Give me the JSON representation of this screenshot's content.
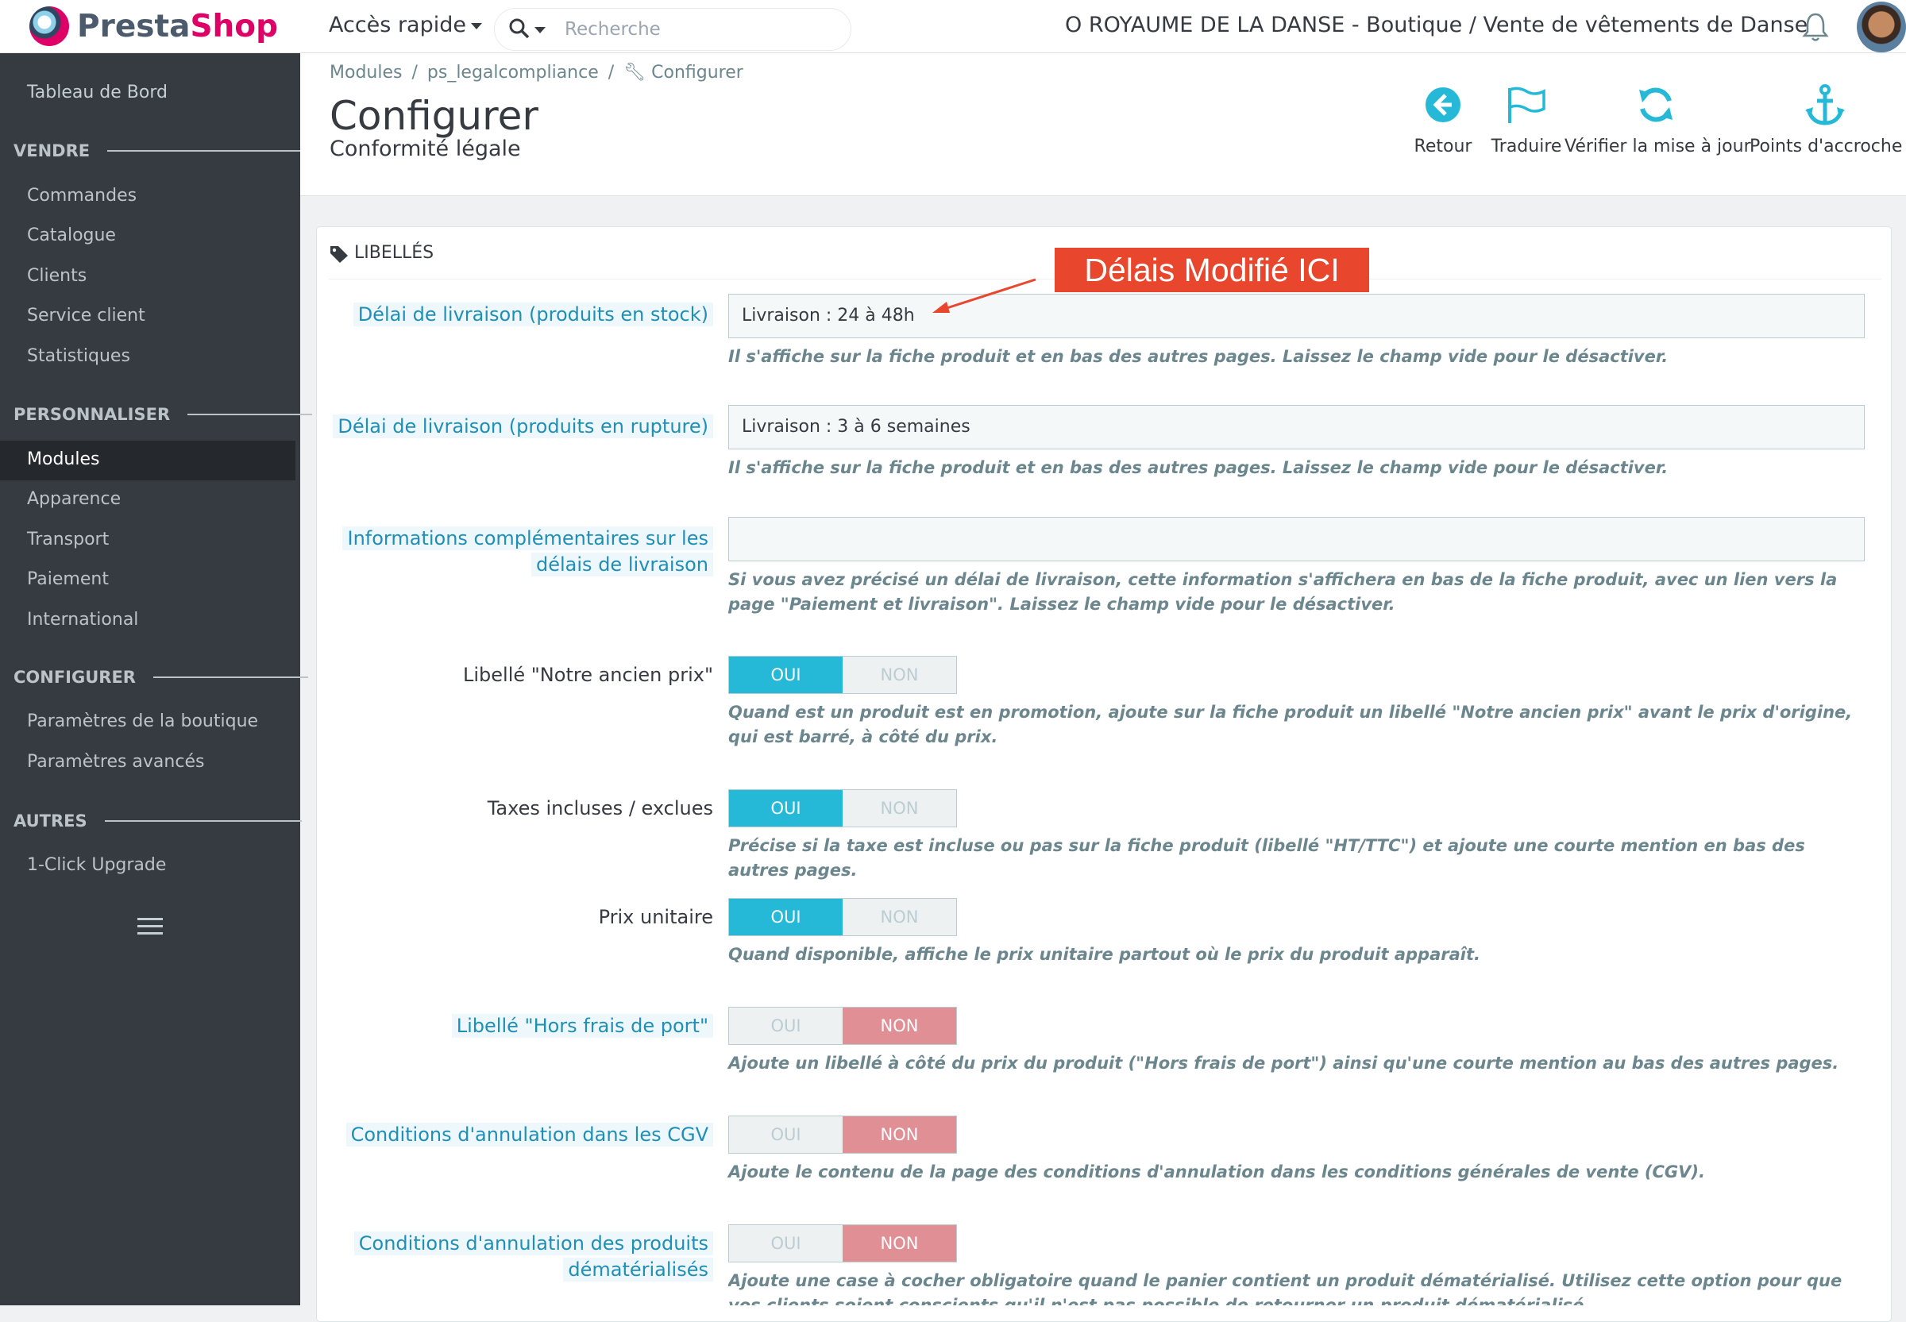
{
  "topbar": {
    "logo_part1": "Presta",
    "logo_part2": "Shop",
    "quick_access": "Accès rapide",
    "search_placeholder": "Recherche",
    "shop_name": "O ROYAUME DE LA DANSE - Boutique / Vente de vêtements de Danse"
  },
  "sidebar": {
    "dashboard": "Tableau de Bord",
    "sections": [
      {
        "title": "VENDRE",
        "items": [
          "Commandes",
          "Catalogue",
          "Clients",
          "Service client",
          "Statistiques"
        ]
      },
      {
        "title": "PERSONNALISER",
        "items": [
          "Modules",
          "Apparence",
          "Transport",
          "Paiement",
          "International"
        ]
      },
      {
        "title": "CONFIGURER",
        "items": [
          "Paramètres de la boutique",
          "Paramètres avancés"
        ]
      },
      {
        "title": "AUTRES",
        "items": [
          "1-Click Upgrade"
        ]
      }
    ],
    "active_item": "Modules"
  },
  "header": {
    "breadcrumb": [
      "Modules",
      "ps_legalcompliance",
      "Configurer"
    ],
    "title": "Configurer",
    "subtitle": "Conformité légale",
    "toolbar": [
      "Retour",
      "Traduire",
      "Vérifier la mise à jour",
      "Points d'accroche"
    ]
  },
  "panel": {
    "title": "LIBELLÉS",
    "annotation": "Délais Modifié ICI",
    "fields": [
      {
        "label": "Délai de livraison (produits en stock)",
        "value": "Livraison : 24 à 48h",
        "help": "Il s'affiche sur la fiche produit et en bas des autres pages. Laissez le champ vide pour le désactiver."
      },
      {
        "label": "Délai de livraison (produits en rupture)",
        "value": "Livraison : 3 à 6 semaines",
        "help": "Il s'affiche sur la fiche produit et en bas des autres pages. Laissez le champ vide pour le désactiver."
      },
      {
        "label_line1": "Informations complémentaires sur les",
        "label_line2": "délais de livraison",
        "value": "",
        "help": "Si vous avez précisé un délai de livraison, cette information s'affichera en bas de la fiche produit, avec un lien vers la page \"Paiement et livraison\". Laissez le champ vide pour le désactiver."
      }
    ],
    "switch_yes": "OUI",
    "switch_no": "NON",
    "switches": [
      {
        "label": "Libellé \"Notre ancien prix\"",
        "value": "OUI",
        "help": "Quand est un produit est en promotion, ajoute sur la fiche produit un libellé \"Notre ancien prix\" avant le prix d'origine, qui est barré, à côté du prix."
      },
      {
        "label": "Taxes incluses / exclues",
        "value": "OUI",
        "help": "Précise si la taxe est incluse ou pas sur la fiche produit (libellé \"HT/TTC\") et ajoute une courte mention en bas des autres pages."
      },
      {
        "label": "Prix unitaire",
        "value": "OUI",
        "help": "Quand disponible, affiche le prix unitaire partout où le prix du produit apparaît."
      },
      {
        "label": "Libellé \"Hors frais de port\"",
        "value": "NON",
        "help": "Ajoute un libellé à côté du prix du produit (\"Hors frais de port\") ainsi qu'une courte mention au bas des autres pages."
      },
      {
        "label": "Conditions d'annulation dans les CGV",
        "value": "NON",
        "help": "Ajoute le contenu de la page des conditions d'annulation dans les conditions générales de vente (CGV)."
      },
      {
        "label_line1": "Conditions d'annulation des produits",
        "label_line2": "dématérialisés",
        "value": "NON",
        "help": "Ajoute une case à cocher obligatoire quand le panier contient un produit dématérialisé. Utilisez cette option pour que vos clients soient conscients qu'il n'est pas possible de retourner un produit dématérialisé."
      }
    ]
  },
  "colors": {
    "brand": "#df0067",
    "sidebar": "#363a41",
    "accent": "#25b9d7",
    "danger": "#e08f95",
    "annotation": "#e8472e"
  }
}
